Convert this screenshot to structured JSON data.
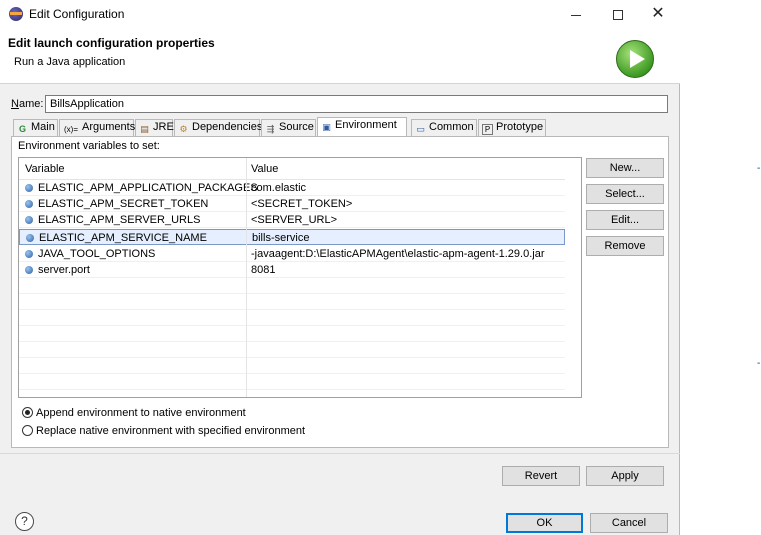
{
  "window": {
    "title": "Edit Configuration",
    "minimize_icon": "minimize-icon",
    "maximize_icon": "maximize-icon",
    "close_glyph": "✕"
  },
  "header": {
    "title": "Edit launch configuration properties",
    "subtitle": "Run a Java application",
    "icon": "run-icon"
  },
  "name_field": {
    "label_access": "N",
    "label_rest": "ame:",
    "value": "BillsApplication"
  },
  "tabs": [
    {
      "label": "Main",
      "icon": "main-tab-icon",
      "glyph": "G"
    },
    {
      "label": "Arguments",
      "icon": "arguments-tab-icon",
      "glyph": "(x)="
    },
    {
      "label": "JRE",
      "icon": "jre-tab-icon",
      "glyph": "▤"
    },
    {
      "label": "Dependencies",
      "icon": "dependencies-tab-icon",
      "glyph": "⚙"
    },
    {
      "label": "Source",
      "icon": "source-tab-icon",
      "glyph": "⇶"
    },
    {
      "label": "Environment",
      "icon": "environment-tab-icon",
      "glyph": "▣"
    },
    {
      "label": "Common",
      "icon": "common-tab-icon",
      "glyph": "▭"
    },
    {
      "label": "Prototype",
      "icon": "prototype-tab-icon",
      "glyph": "P"
    }
  ],
  "active_tab": "Environment",
  "env": {
    "label": "Environment variables to set:",
    "columns": [
      "Variable",
      "Value"
    ],
    "rows": [
      {
        "name": "ELASTIC_APM_APPLICATION_PACKAGES",
        "value": "com.elastic"
      },
      {
        "name": "ELASTIC_APM_SECRET_TOKEN",
        "value": "<SECRET_TOKEN>"
      },
      {
        "name": "ELASTIC_APM_SERVER_URLS",
        "value": "<SERVER_URL>"
      },
      {
        "name": "ELASTIC_APM_SERVICE_NAME",
        "value": "bills-service"
      },
      {
        "name": "JAVA_TOOL_OPTIONS",
        "value": "-javaagent:D:\\ElasticAPMAgent\\elastic-apm-agent-1.29.0.jar"
      },
      {
        "name": "server.port",
        "value": "8081"
      }
    ],
    "selected_row": 3,
    "buttons": [
      "New...",
      "Select...",
      "Edit...",
      "Remove"
    ],
    "append_option": "Append environment to native environment",
    "replace_option": "Replace native environment with specified environment",
    "selected_option": "append"
  },
  "footer": {
    "revert": "Revert",
    "apply": "Apply",
    "ok": "OK",
    "cancel": "Cancel",
    "help_glyph": "?"
  },
  "accent_color": "#0078d7"
}
